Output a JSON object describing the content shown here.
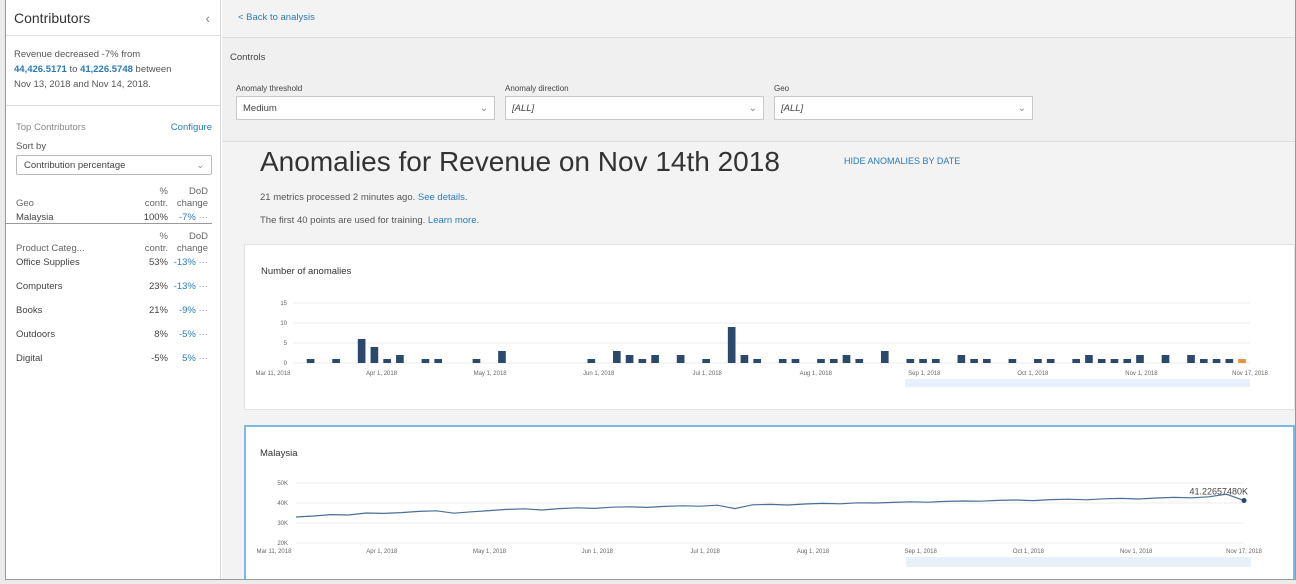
{
  "sidebar": {
    "title": "Contributors",
    "collapse_icon": "chevron-left-icon",
    "summary": {
      "prefix": "Revenue decreased -7% from",
      "from_value": "44,426.5171",
      "to_word": "to",
      "to_value": "41,226.5748",
      "between": "between",
      "dates": "Nov 13, 2018 and Nov 14, 2018."
    },
    "top_contributors_label": "Top Contributors",
    "configure_label": "Configure",
    "sort_by_label": "Sort by",
    "sort_by_value": "Contribution percentage",
    "groups": [
      {
        "dimension": "Geo",
        "pct_header_top": "%",
        "pct_header_bottom": "contr.",
        "dod_header_top": "DoD",
        "dod_header_bottom": "change",
        "rows": [
          {
            "name": "Malaysia",
            "pct": "100%",
            "dod": "-7%"
          }
        ]
      },
      {
        "dimension": "Product Categ...",
        "pct_header_top": "%",
        "pct_header_bottom": "contr.",
        "dod_header_top": "DoD",
        "dod_header_bottom": "change",
        "rows": [
          {
            "name": "Office Supplies",
            "pct": "53%",
            "dod": "-13%"
          },
          {
            "name": "Computers",
            "pct": "23%",
            "dod": "-13%"
          },
          {
            "name": "Books",
            "pct": "21%",
            "dod": "-9%"
          },
          {
            "name": "Outdoors",
            "pct": "8%",
            "dod": "-5%"
          },
          {
            "name": "Digital",
            "pct": "-5%",
            "dod": "5%"
          }
        ]
      }
    ],
    "more_glyph": "···"
  },
  "main": {
    "back_label": "< Back to analysis",
    "controls": {
      "title": "Controls",
      "fields": [
        {
          "label": "Anomaly threshold",
          "value": "Medium"
        },
        {
          "label": "Anomaly direction",
          "value": "[ALL]"
        },
        {
          "label": "Geo",
          "value": "[ALL]"
        }
      ]
    },
    "heading": "Anomalies for Revenue on Nov 14th 2018",
    "hide_link": "HIDE ANOMALIES BY DATE",
    "meta1_text": "21 metrics processed 2 minutes ago.",
    "meta1_link": "See details.",
    "meta2_text": "The first 40 points are used for training.",
    "meta2_link": "Learn more."
  },
  "chart_data": [
    {
      "type": "bar",
      "title": "Number of anomalies",
      "x_tick_labels": [
        "Mar 11, 2018",
        "Apr 1, 2018",
        "May 1, 2018",
        "Jun 1, 2018",
        "Jul 1, 2018",
        "Aug 1, 2018",
        "Sep 1, 2018",
        "Oct 1, 2018",
        "Nov 1, 2018",
        "Nov 17, 2018"
      ],
      "y_tick_labels": [
        "0",
        "5",
        "10",
        "15"
      ],
      "ylim": [
        0,
        15
      ],
      "values": [
        0,
        1,
        0,
        1,
        0,
        6,
        4,
        1,
        2,
        0,
        1,
        1,
        0,
        0,
        1,
        0,
        3,
        0,
        0,
        0,
        0,
        0,
        0,
        1,
        0,
        3,
        2,
        1,
        2,
        0,
        2,
        0,
        1,
        0,
        9,
        2,
        1,
        0,
        1,
        1,
        0,
        1,
        1,
        2,
        1,
        0,
        3,
        0,
        1,
        1,
        1,
        0,
        2,
        1,
        1,
        0,
        1,
        0,
        1,
        1,
        0,
        1,
        2,
        1,
        1,
        1,
        2,
        0,
        2,
        0,
        2,
        1,
        1,
        1,
        1
      ],
      "colors": {
        "bar": "#2b4a6b",
        "latest": "#e8943a"
      }
    },
    {
      "type": "line",
      "title": "Malaysia",
      "annotation": "41.22657480K",
      "x_tick_labels": [
        "Mar 11, 2018",
        "Apr 1, 2018",
        "May 1, 2018",
        "Jun 1, 2018",
        "Jul 1, 2018",
        "Aug 1, 2018",
        "Sep 1, 2018",
        "Oct 1, 2018",
        "Nov 1, 2018",
        "Nov 17, 2018"
      ],
      "y_tick_labels": [
        "20K",
        "30K",
        "40K",
        "50K"
      ],
      "ylim": [
        20000,
        50000
      ],
      "values": [
        33000,
        33500,
        34200,
        34000,
        35000,
        34800,
        35200,
        35800,
        36100,
        34900,
        35600,
        36200,
        36800,
        37100,
        36500,
        37200,
        37600,
        37300,
        37900,
        38100,
        37800,
        38300,
        38600,
        38400,
        38900,
        37200,
        39100,
        39300,
        39000,
        39500,
        39800,
        39600,
        40100,
        40000,
        40300,
        40600,
        40400,
        40800,
        41000,
        40900,
        41300,
        41500,
        41200,
        41700,
        41900,
        41600,
        42100,
        42300,
        42000,
        42500,
        42800,
        42600,
        43100,
        44426.5171,
        41226.5748
      ],
      "colors": {
        "line": "#4a6f95"
      }
    }
  ]
}
